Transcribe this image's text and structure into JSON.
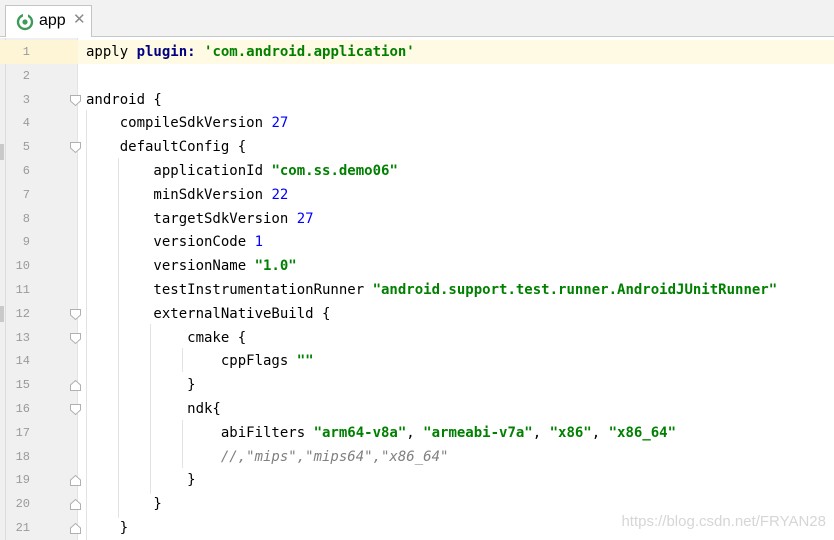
{
  "tab": {
    "title": "app",
    "close_symbol": "✕"
  },
  "lines": [
    {
      "n": "1",
      "segs": [
        {
          "t": "apply ",
          "c": "plain"
        },
        {
          "t": "plugin: ",
          "c": "kw"
        },
        {
          "t": "'com.android.application'",
          "c": "str"
        }
      ]
    },
    {
      "n": "2",
      "segs": []
    },
    {
      "n": "3",
      "segs": [
        {
          "t": "android {",
          "c": "plain"
        }
      ]
    },
    {
      "n": "4",
      "segs": [
        {
          "t": "    compileSdkVersion ",
          "c": "plain"
        },
        {
          "t": "27",
          "c": "num"
        }
      ]
    },
    {
      "n": "5",
      "segs": [
        {
          "t": "    defaultConfig {",
          "c": "plain"
        }
      ]
    },
    {
      "n": "6",
      "segs": [
        {
          "t": "        applicationId ",
          "c": "plain"
        },
        {
          "t": "\"com.ss.demo06\"",
          "c": "str"
        }
      ]
    },
    {
      "n": "7",
      "segs": [
        {
          "t": "        minSdkVersion ",
          "c": "plain"
        },
        {
          "t": "22",
          "c": "num"
        }
      ]
    },
    {
      "n": "8",
      "segs": [
        {
          "t": "        targetSdkVersion ",
          "c": "plain"
        },
        {
          "t": "27",
          "c": "num"
        }
      ]
    },
    {
      "n": "9",
      "segs": [
        {
          "t": "        versionCode ",
          "c": "plain"
        },
        {
          "t": "1",
          "c": "num"
        }
      ]
    },
    {
      "n": "10",
      "segs": [
        {
          "t": "        versionName ",
          "c": "plain"
        },
        {
          "t": "\"1.0\"",
          "c": "str"
        }
      ]
    },
    {
      "n": "11",
      "segs": [
        {
          "t": "        testInstrumentationRunner ",
          "c": "plain"
        },
        {
          "t": "\"android.support.test.runner.AndroidJUnitRunner\"",
          "c": "str"
        }
      ]
    },
    {
      "n": "12",
      "segs": [
        {
          "t": "        externalNativeBuild {",
          "c": "plain"
        }
      ]
    },
    {
      "n": "13",
      "segs": [
        {
          "t": "            cmake {",
          "c": "plain"
        }
      ]
    },
    {
      "n": "14",
      "segs": [
        {
          "t": "                cppFlags ",
          "c": "plain"
        },
        {
          "t": "\"\"",
          "c": "str"
        }
      ]
    },
    {
      "n": "15",
      "segs": [
        {
          "t": "            }",
          "c": "plain"
        }
      ]
    },
    {
      "n": "16",
      "segs": [
        {
          "t": "            ndk{",
          "c": "plain"
        }
      ]
    },
    {
      "n": "17",
      "segs": [
        {
          "t": "                abiFilters ",
          "c": "plain"
        },
        {
          "t": "\"arm64-v8a\"",
          "c": "str"
        },
        {
          "t": ", ",
          "c": "plain"
        },
        {
          "t": "\"armeabi-v7a\"",
          "c": "str"
        },
        {
          "t": ", ",
          "c": "plain"
        },
        {
          "t": "\"x86\"",
          "c": "str"
        },
        {
          "t": ", ",
          "c": "plain"
        },
        {
          "t": "\"x86_64\"",
          "c": "str"
        }
      ]
    },
    {
      "n": "18",
      "segs": [
        {
          "t": "                //,\"mips\",\"mips64\",\"x86_64\"",
          "c": "cmt"
        }
      ]
    },
    {
      "n": "19",
      "segs": [
        {
          "t": "            }",
          "c": "plain"
        }
      ]
    },
    {
      "n": "20",
      "segs": [
        {
          "t": "        }",
          "c": "plain"
        }
      ]
    },
    {
      "n": "21",
      "segs": [
        {
          "t": "    }",
          "c": "plain"
        }
      ]
    }
  ],
  "fold_markers": [
    {
      "line": "3",
      "kind": "fold-open-icon"
    },
    {
      "line": "5",
      "kind": "fold-open-icon"
    },
    {
      "line": "12",
      "kind": "fold-open-icon"
    },
    {
      "line": "13",
      "kind": "fold-open-icon"
    },
    {
      "line": "15",
      "kind": "fold-close-icon"
    },
    {
      "line": "16",
      "kind": "fold-open-icon"
    },
    {
      "line": "19",
      "kind": "fold-close-icon"
    },
    {
      "line": "20",
      "kind": "fold-close-icon"
    },
    {
      "line": "21",
      "kind": "fold-close-icon"
    }
  ],
  "watermark": "https://blog.csdn.net/FRYAN28",
  "colors": {
    "keyword": "#000080",
    "string": "#008000",
    "number": "#0000ff",
    "comment": "#808080",
    "current_line": "#fffae3",
    "gutter": "#f0f0f0"
  }
}
